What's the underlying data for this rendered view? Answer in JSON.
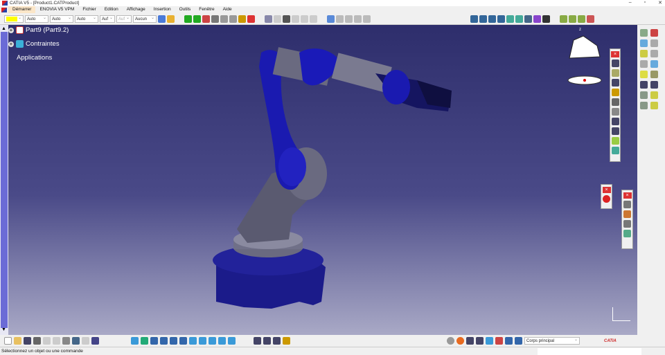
{
  "window": {
    "title": "CATIA V5 - [Product1.CATProduct]"
  },
  "menu": [
    "Démarrer",
    "ENOVIA V5 VPM",
    "Fichier",
    "Edition",
    "Affichage",
    "Insertion",
    "Outils",
    "Fenêtre",
    "Aide"
  ],
  "toolbar": {
    "color": "#ffff00",
    "selects": [
      "Auto",
      "Auto",
      "Auto",
      "Auf",
      "Auf",
      "Aucun"
    ]
  },
  "tree": {
    "items": [
      {
        "label": "Part9 (Part9.2)"
      },
      {
        "label": "Contraintes"
      },
      {
        "label": "Applications"
      }
    ]
  },
  "bottom": {
    "body_select": "Corps principal",
    "brand": "CATIA"
  },
  "status": {
    "text": "Sélectionnez un objet ou une commande"
  },
  "compass": {
    "axis": "z"
  }
}
